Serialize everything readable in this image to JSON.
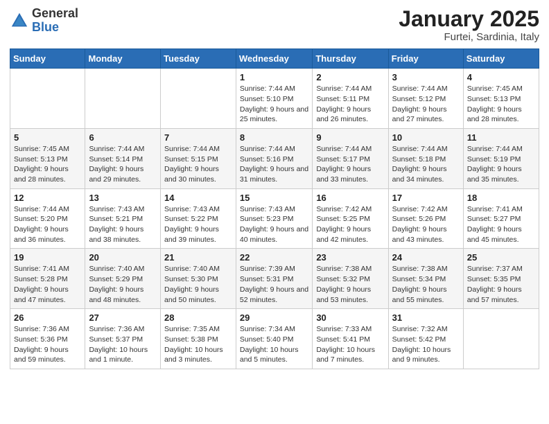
{
  "header": {
    "logo_general": "General",
    "logo_blue": "Blue",
    "month_title": "January 2025",
    "location": "Furtei, Sardinia, Italy"
  },
  "weekdays": [
    "Sunday",
    "Monday",
    "Tuesday",
    "Wednesday",
    "Thursday",
    "Friday",
    "Saturday"
  ],
  "weeks": [
    [
      {
        "day": "",
        "info": ""
      },
      {
        "day": "",
        "info": ""
      },
      {
        "day": "",
        "info": ""
      },
      {
        "day": "1",
        "info": "Sunrise: 7:44 AM\nSunset: 5:10 PM\nDaylight: 9 hours and 25 minutes."
      },
      {
        "day": "2",
        "info": "Sunrise: 7:44 AM\nSunset: 5:11 PM\nDaylight: 9 hours and 26 minutes."
      },
      {
        "day": "3",
        "info": "Sunrise: 7:44 AM\nSunset: 5:12 PM\nDaylight: 9 hours and 27 minutes."
      },
      {
        "day": "4",
        "info": "Sunrise: 7:45 AM\nSunset: 5:13 PM\nDaylight: 9 hours and 28 minutes."
      }
    ],
    [
      {
        "day": "5",
        "info": "Sunrise: 7:45 AM\nSunset: 5:13 PM\nDaylight: 9 hours and 28 minutes."
      },
      {
        "day": "6",
        "info": "Sunrise: 7:44 AM\nSunset: 5:14 PM\nDaylight: 9 hours and 29 minutes."
      },
      {
        "day": "7",
        "info": "Sunrise: 7:44 AM\nSunset: 5:15 PM\nDaylight: 9 hours and 30 minutes."
      },
      {
        "day": "8",
        "info": "Sunrise: 7:44 AM\nSunset: 5:16 PM\nDaylight: 9 hours and 31 minutes."
      },
      {
        "day": "9",
        "info": "Sunrise: 7:44 AM\nSunset: 5:17 PM\nDaylight: 9 hours and 33 minutes."
      },
      {
        "day": "10",
        "info": "Sunrise: 7:44 AM\nSunset: 5:18 PM\nDaylight: 9 hours and 34 minutes."
      },
      {
        "day": "11",
        "info": "Sunrise: 7:44 AM\nSunset: 5:19 PM\nDaylight: 9 hours and 35 minutes."
      }
    ],
    [
      {
        "day": "12",
        "info": "Sunrise: 7:44 AM\nSunset: 5:20 PM\nDaylight: 9 hours and 36 minutes."
      },
      {
        "day": "13",
        "info": "Sunrise: 7:43 AM\nSunset: 5:21 PM\nDaylight: 9 hours and 38 minutes."
      },
      {
        "day": "14",
        "info": "Sunrise: 7:43 AM\nSunset: 5:22 PM\nDaylight: 9 hours and 39 minutes."
      },
      {
        "day": "15",
        "info": "Sunrise: 7:43 AM\nSunset: 5:23 PM\nDaylight: 9 hours and 40 minutes."
      },
      {
        "day": "16",
        "info": "Sunrise: 7:42 AM\nSunset: 5:25 PM\nDaylight: 9 hours and 42 minutes."
      },
      {
        "day": "17",
        "info": "Sunrise: 7:42 AM\nSunset: 5:26 PM\nDaylight: 9 hours and 43 minutes."
      },
      {
        "day": "18",
        "info": "Sunrise: 7:41 AM\nSunset: 5:27 PM\nDaylight: 9 hours and 45 minutes."
      }
    ],
    [
      {
        "day": "19",
        "info": "Sunrise: 7:41 AM\nSunset: 5:28 PM\nDaylight: 9 hours and 47 minutes."
      },
      {
        "day": "20",
        "info": "Sunrise: 7:40 AM\nSunset: 5:29 PM\nDaylight: 9 hours and 48 minutes."
      },
      {
        "day": "21",
        "info": "Sunrise: 7:40 AM\nSunset: 5:30 PM\nDaylight: 9 hours and 50 minutes."
      },
      {
        "day": "22",
        "info": "Sunrise: 7:39 AM\nSunset: 5:31 PM\nDaylight: 9 hours and 52 minutes."
      },
      {
        "day": "23",
        "info": "Sunrise: 7:38 AM\nSunset: 5:32 PM\nDaylight: 9 hours and 53 minutes."
      },
      {
        "day": "24",
        "info": "Sunrise: 7:38 AM\nSunset: 5:34 PM\nDaylight: 9 hours and 55 minutes."
      },
      {
        "day": "25",
        "info": "Sunrise: 7:37 AM\nSunset: 5:35 PM\nDaylight: 9 hours and 57 minutes."
      }
    ],
    [
      {
        "day": "26",
        "info": "Sunrise: 7:36 AM\nSunset: 5:36 PM\nDaylight: 9 hours and 59 minutes."
      },
      {
        "day": "27",
        "info": "Sunrise: 7:36 AM\nSunset: 5:37 PM\nDaylight: 10 hours and 1 minute."
      },
      {
        "day": "28",
        "info": "Sunrise: 7:35 AM\nSunset: 5:38 PM\nDaylight: 10 hours and 3 minutes."
      },
      {
        "day": "29",
        "info": "Sunrise: 7:34 AM\nSunset: 5:40 PM\nDaylight: 10 hours and 5 minutes."
      },
      {
        "day": "30",
        "info": "Sunrise: 7:33 AM\nSunset: 5:41 PM\nDaylight: 10 hours and 7 minutes."
      },
      {
        "day": "31",
        "info": "Sunrise: 7:32 AM\nSunset: 5:42 PM\nDaylight: 10 hours and 9 minutes."
      },
      {
        "day": "",
        "info": ""
      }
    ]
  ]
}
